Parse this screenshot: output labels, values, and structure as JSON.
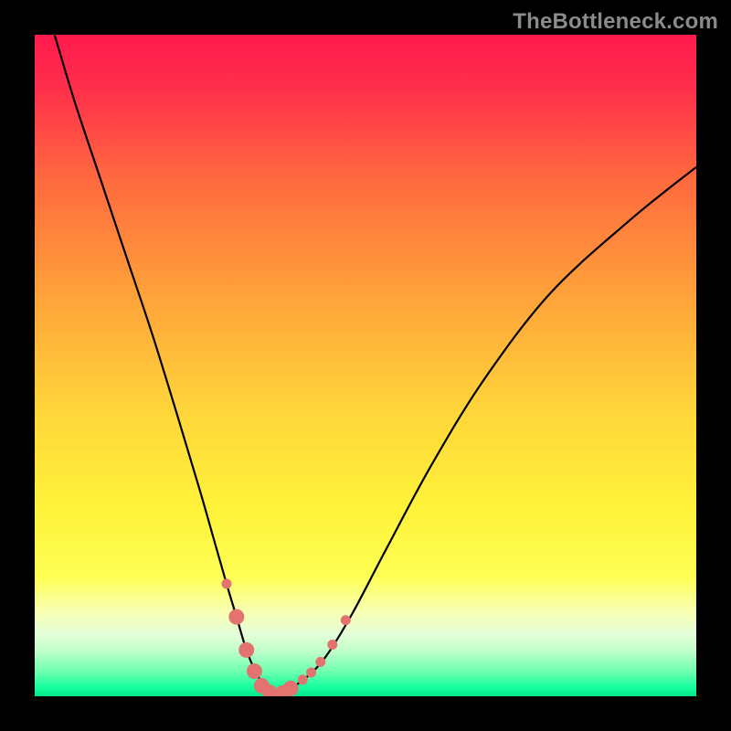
{
  "watermark": "TheBottleneck.com",
  "chart_data": {
    "type": "line",
    "title": "",
    "xlabel": "",
    "ylabel": "",
    "xlim": [
      0,
      100
    ],
    "ylim": [
      0,
      100
    ],
    "gradient_stops": [
      {
        "offset": 0,
        "color": "#ff1a4d"
      },
      {
        "offset": 0.08,
        "color": "#ff2f4b"
      },
      {
        "offset": 0.22,
        "color": "#ff6a3e"
      },
      {
        "offset": 0.4,
        "color": "#ffa43a"
      },
      {
        "offset": 0.58,
        "color": "#ffd83a"
      },
      {
        "offset": 0.72,
        "color": "#fff33a"
      },
      {
        "offset": 0.82,
        "color": "#fdff55"
      },
      {
        "offset": 0.87,
        "color": "#f8ffb0"
      },
      {
        "offset": 0.905,
        "color": "#e6ffd8"
      },
      {
        "offset": 0.935,
        "color": "#b8ffc8"
      },
      {
        "offset": 0.965,
        "color": "#66ffad"
      },
      {
        "offset": 0.985,
        "color": "#1aff9e"
      },
      {
        "offset": 1.0,
        "color": "#00e68c"
      }
    ],
    "series": [
      {
        "name": "bottleneck-curve",
        "x": [
          3,
          6,
          10,
          14,
          18,
          22,
          25,
          27,
          29,
          30.5,
          32,
          33.5,
          35,
          36.5,
          38,
          41,
          44,
          48,
          53,
          60,
          68,
          78,
          90,
          100
        ],
        "y": [
          100,
          90,
          78,
          66,
          54,
          41,
          31,
          24,
          17,
          12,
          7,
          3.5,
          1.2,
          0.3,
          0.8,
          2.8,
          6,
          12.5,
          22,
          35,
          48,
          61,
          72,
          80
        ]
      }
    ],
    "markers": {
      "color": "#e2736f",
      "radius_small": 5.5,
      "radius_large": 8.5,
      "points_left": [
        {
          "x": 29.0,
          "y": 17,
          "r": "small"
        },
        {
          "x": 30.5,
          "y": 12,
          "r": "large"
        },
        {
          "x": 32.0,
          "y": 7,
          "r": "large"
        },
        {
          "x": 33.2,
          "y": 3.8,
          "r": "large"
        },
        {
          "x": 34.3,
          "y": 1.6,
          "r": "large"
        },
        {
          "x": 35.5,
          "y": 0.6,
          "r": "large"
        }
      ],
      "points_right": [
        {
          "x": 37.5,
          "y": 0.5,
          "r": "large"
        },
        {
          "x": 38.7,
          "y": 1.2,
          "r": "large"
        },
        {
          "x": 40.5,
          "y": 2.5,
          "r": "small"
        },
        {
          "x": 41.8,
          "y": 3.6,
          "r": "small"
        },
        {
          "x": 43.2,
          "y": 5.2,
          "r": "small"
        },
        {
          "x": 45.0,
          "y": 7.8,
          "r": "small"
        },
        {
          "x": 47.0,
          "y": 11.5,
          "r": "small"
        }
      ]
    }
  }
}
